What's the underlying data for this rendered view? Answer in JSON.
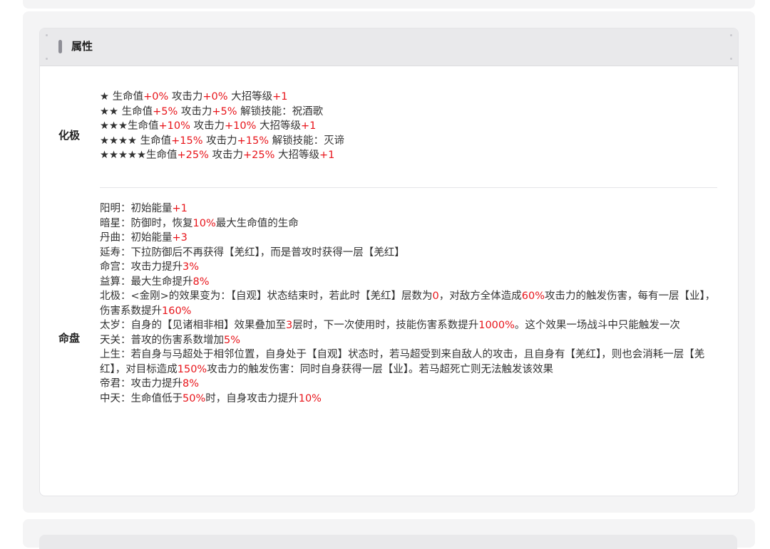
{
  "section": {
    "title": "属性"
  },
  "huaji": {
    "label": "化极",
    "lines": [
      [
        {
          "t": "★ 生命值"
        },
        {
          "t": "+0%",
          "r": true
        },
        {
          "t": " 攻击力"
        },
        {
          "t": "+0%",
          "r": true
        },
        {
          "t": " 大招等级"
        },
        {
          "t": "+1",
          "r": true
        }
      ],
      [
        {
          "t": "★★ 生命值"
        },
        {
          "t": "+5%",
          "r": true
        },
        {
          "t": " 攻击力"
        },
        {
          "t": "+5%",
          "r": true
        },
        {
          "t": " 解锁技能：祝酒歌"
        }
      ],
      [
        {
          "t": "★★★生命值"
        },
        {
          "t": "+10%",
          "r": true
        },
        {
          "t": " 攻击力"
        },
        {
          "t": "+10%",
          "r": true
        },
        {
          "t": " 大招等级"
        },
        {
          "t": "+1",
          "r": true
        }
      ],
      [
        {
          "t": "★★★★ 生命值"
        },
        {
          "t": "+15%",
          "r": true
        },
        {
          "t": " 攻击力"
        },
        {
          "t": "+15%",
          "r": true
        },
        {
          "t": " 解锁技能：灭谛"
        }
      ],
      [
        {
          "t": "★★★★★生命值"
        },
        {
          "t": "+25%",
          "r": true
        },
        {
          "t": " 攻击力"
        },
        {
          "t": "+25%",
          "r": true
        },
        {
          "t": " 大招等级"
        },
        {
          "t": "+1",
          "r": true
        }
      ]
    ]
  },
  "mingpan": {
    "label": "命盘",
    "lines": [
      [
        {
          "t": "阳明：初始能量"
        },
        {
          "t": "+1",
          "r": true
        }
      ],
      [
        {
          "t": "暗星：防御时，恢复"
        },
        {
          "t": "10%",
          "r": true
        },
        {
          "t": "最大生命值的生命"
        }
      ],
      [
        {
          "t": "丹曲：初始能量"
        },
        {
          "t": "+3",
          "r": true
        }
      ],
      [
        {
          "t": "延寿：下拉防御后不再获得【羌红】，而是普攻时获得一层【羌红】"
        }
      ],
      [
        {
          "t": "命宫：攻击力提升"
        },
        {
          "t": "3%",
          "r": true
        }
      ],
      [
        {
          "t": "益算：最大生命提升"
        },
        {
          "t": "8%",
          "r": true
        }
      ],
      [
        {
          "t": "北极：<金刚>的效果变为：【自观】状态结束时，若此时【羌红】层数为"
        },
        {
          "t": "0",
          "r": true
        },
        {
          "t": "，对敌方全体造成"
        },
        {
          "t": "60%",
          "r": true
        },
        {
          "t": "攻击力的触发伤害，每有一层【业】，伤害系数提升"
        },
        {
          "t": "160%",
          "r": true
        }
      ],
      [
        {
          "t": "太岁：自身的【见诸相非相】效果叠加至"
        },
        {
          "t": "3",
          "r": true
        },
        {
          "t": "层时，下一次使用时，技能伤害系数提升"
        },
        {
          "t": "1000%",
          "r": true
        },
        {
          "t": "。这个效果一场战斗中只能触发一次"
        }
      ],
      [
        {
          "t": "天关：普攻的伤害系数增加"
        },
        {
          "t": "5%",
          "r": true
        }
      ],
      [
        {
          "t": "上生：若自身与马超处于相邻位置，自身处于【自观】状态时，若马超受到来自敌人的攻击，且自身有【羌红】，则也会消耗一层【羌红】，对目标造成"
        },
        {
          "t": "150%",
          "r": true
        },
        {
          "t": "攻击力的触发伤害：同时自身获得一层【业】。若马超死亡则无法触发该效果"
        }
      ],
      [
        {
          "t": "帝君：攻击力提升"
        },
        {
          "t": "8%",
          "r": true
        }
      ],
      [
        {
          "t": "中天：生命值低于"
        },
        {
          "t": "50%",
          "r": true
        },
        {
          "t": "时，自身攻击力提升"
        },
        {
          "t": "10%",
          "r": true
        }
      ]
    ]
  }
}
